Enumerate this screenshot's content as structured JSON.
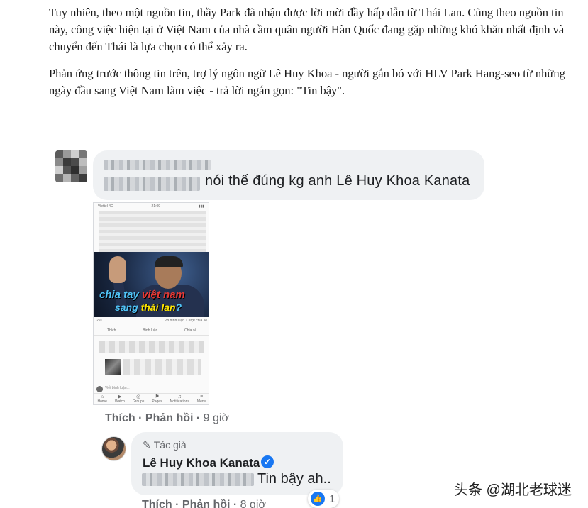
{
  "article": {
    "paragraph1": "Tuy nhiên, theo một nguồn tin, thầy Park đã nhận được lời mời đầy hấp dẫn từ Thái Lan. Cũng theo nguồn tin này, công việc hiện tại ở Việt Nam của nhà cầm quân người Hàn Quốc đang gặp những khó khăn nhất định và chuyển đến Thái là lựa chọn có thể xảy ra.",
    "paragraph2": "Phản ứng trước thông tin trên, trợ lý ngôn ngữ Lê Huy Khoa - người gắn bó với HLV Park Hang-seo từ những ngày đầu sang Việt Nam làm việc - trả lời ngắn gọn: \"Tin bậy\"."
  },
  "comment1": {
    "text": "nói thế đúng kg anh Lê Huy Khoa Kanata",
    "like_label": "Thích",
    "reply_label": "Phản hồi",
    "separator": " · ",
    "time": "9 giờ",
    "screenshot": {
      "status_left": "Viettel 4G",
      "status_time": "21:09",
      "photo_line1_a": "chia tay ",
      "photo_line1_b": "việt nam",
      "photo_line2_a": "sang ",
      "photo_line2_b": "thái lan",
      "photo_line2_c": "?",
      "reactions": "291",
      "comments_shares": "28 bình luận  1 lượt chia sẻ",
      "action_like": "Thích",
      "action_comment": "Bình luận",
      "action_share": "Chia sẻ",
      "write_comment": "Viết bình luận...",
      "nav_home": "Home",
      "nav_watch": "Watch",
      "nav_groups": "Groups",
      "nav_pages": "Pages",
      "nav_notif": "Notifications",
      "nav_menu": "Menu"
    }
  },
  "reply": {
    "author_tag": "Tác giả",
    "author_name": "Lê Huy Khoa Kanata",
    "text": "Tin bậy ah..",
    "like_count": "1",
    "like_label": "Thích",
    "reply_label": "Phản hồi",
    "separator": " · ",
    "time": "8 giờ"
  },
  "watermark": "头条 @湖北老球迷",
  "colors": {
    "bubble_bg": "#eff1f3",
    "meta_text": "#65676b",
    "facebook_blue": "#1877f2"
  }
}
